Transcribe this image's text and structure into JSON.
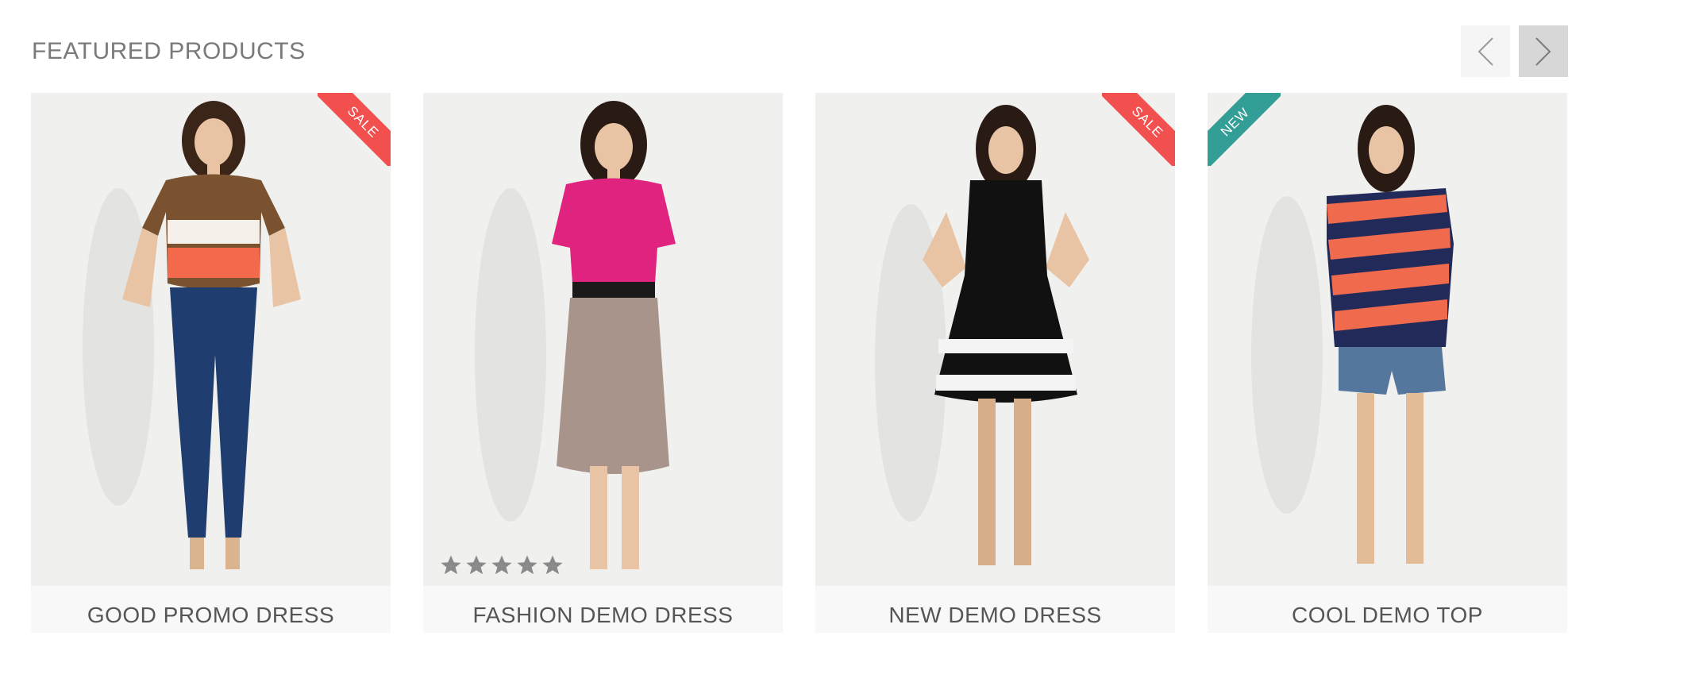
{
  "section": {
    "title": "FEATURED PRODUCTS"
  },
  "carousel": {
    "prev_icon": "chevron-left-icon",
    "next_icon": "chevron-right-icon"
  },
  "products": [
    {
      "name": "GOOD PROMO DRESS",
      "badge": "SALE",
      "badge_color": "#f2504f",
      "outfit": {
        "top": "#7a5230",
        "band1": "#f5f1ea",
        "band2": "#f26a4b",
        "bottom": "#1f3d6e"
      }
    },
    {
      "name": "FASHION DEMO DRESS",
      "badge": "",
      "rating": 5,
      "outfit": {
        "top": "#e0237f",
        "belt": "#1a1a1a",
        "skirt": "#a8948a"
      }
    },
    {
      "name": "NEW DEMO DRESS",
      "badge": "SALE",
      "badge_color": "#f2504f",
      "outfit": {
        "dress": "#111111",
        "stripe": "#f4f4f4"
      }
    },
    {
      "name": "COOL DEMO TOP",
      "badge": "NEW",
      "badge_color": "#339e96",
      "outfit": {
        "stripe1": "#f06a4e",
        "stripe2": "#222a5a",
        "shorts": "#56779d"
      }
    }
  ],
  "colors": {
    "sale": "#f2504f",
    "new": "#339e96",
    "star": "#8a8a8a",
    "name_bar": "#f8f8f8"
  }
}
